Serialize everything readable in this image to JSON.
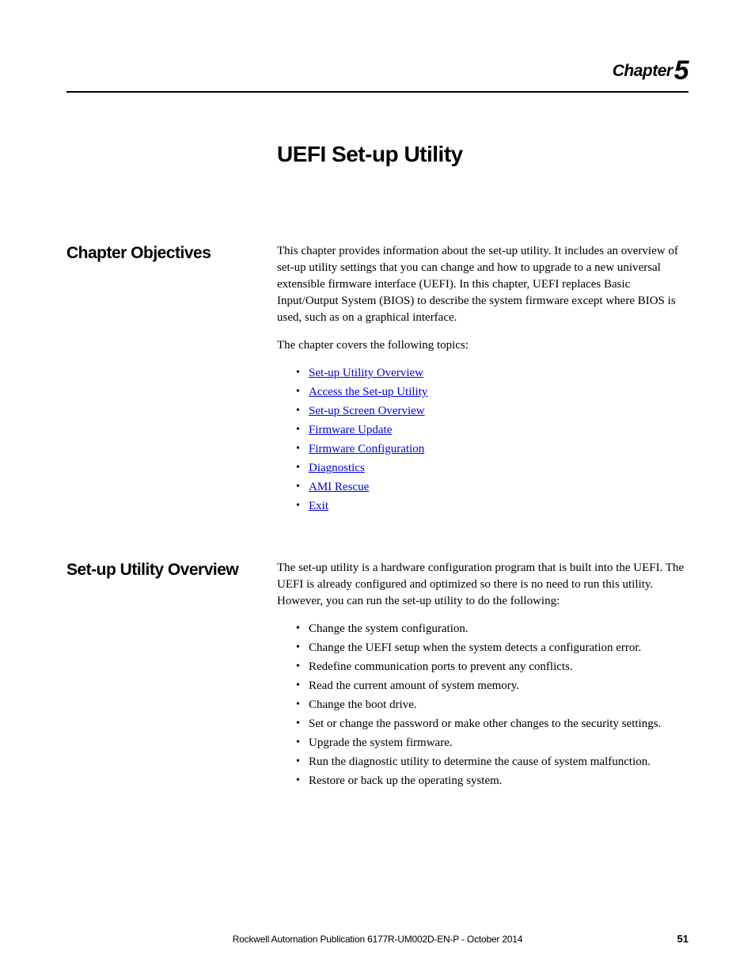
{
  "chapter": {
    "word": "Chapter",
    "number": "5"
  },
  "title": "UEFI Set-up Utility",
  "sections": {
    "objectives": {
      "heading": "Chapter Objectives",
      "p1": "This chapter provides information about the set-up utility. It includes an overview of set-up utility settings that you can change and how to upgrade to a new universal extensible firmware interface (UEFI). In this chapter, UEFI replaces Basic Input/Output System (BIOS) to describe the system firmware except where BIOS is used, such as on a graphical interface.",
      "p2": "The chapter covers the following topics:",
      "links": [
        "Set-up Utility Overview",
        "Access the Set-up Utility",
        "Set-up Screen Overview",
        "Firmware Update",
        "Firmware Configuration",
        "Diagnostics",
        "AMI Rescue",
        "Exit"
      ]
    },
    "overview": {
      "heading": "Set-up Utility Overview",
      "p1": "The set-up utility is a hardware configuration program that is built into the UEFI. The UEFI is already configured and optimized so there is no need to run this utility. However, you can run the set-up utility to do the following:",
      "items": [
        "Change the system configuration.",
        "Change the UEFI setup when the system detects a configuration error.",
        "Redefine communication ports to prevent any conflicts.",
        "Read the current amount of system memory.",
        "Change the boot drive.",
        "Set or change the password or make other changes to the security settings.",
        "Upgrade the system firmware.",
        "Run the diagnostic utility to determine the cause of system malfunction.",
        "Restore or back up the operating system."
      ]
    }
  },
  "footer": {
    "publication": "Rockwell Automation Publication 6177R-UM002D-EN-P - October 2014",
    "page": "51"
  }
}
